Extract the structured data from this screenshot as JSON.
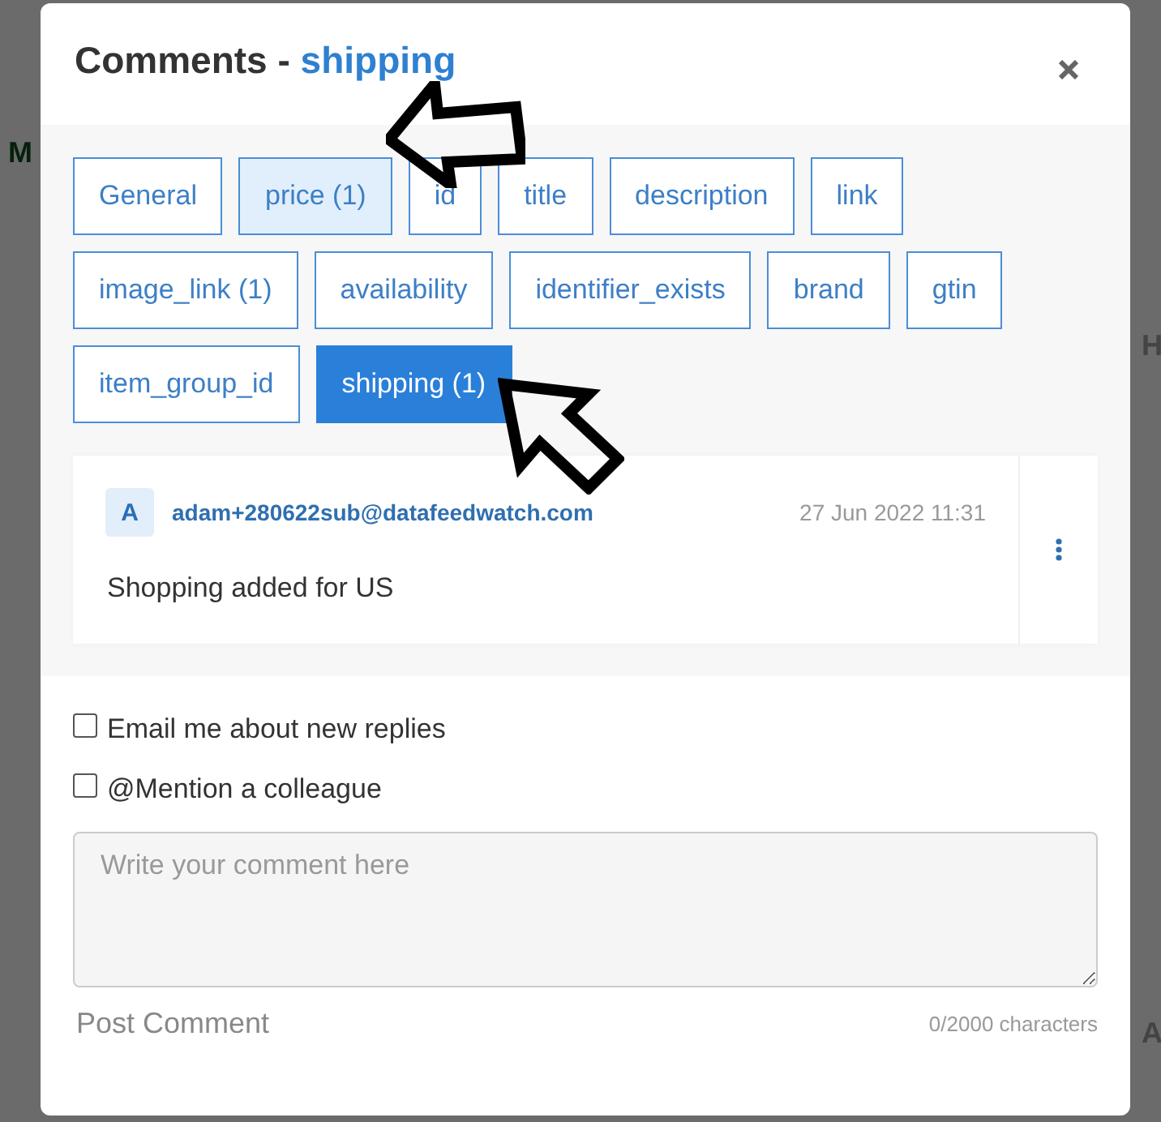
{
  "background": {
    "left_text": "M",
    "right_texts": [
      "H",
      "A"
    ]
  },
  "dialog": {
    "title": "Comments - ",
    "title_field": "shipping",
    "tabs": [
      {
        "label": "General",
        "selected": false,
        "highlighted": false
      },
      {
        "label": "price (1)",
        "selected": false,
        "highlighted": true
      },
      {
        "label": "id",
        "selected": false,
        "highlighted": false
      },
      {
        "label": "title",
        "selected": false,
        "highlighted": false
      },
      {
        "label": "description",
        "selected": false,
        "highlighted": false
      },
      {
        "label": "link",
        "selected": false,
        "highlighted": false
      },
      {
        "label": "image_link (1)",
        "selected": false,
        "highlighted": false
      },
      {
        "label": "availability",
        "selected": false,
        "highlighted": false
      },
      {
        "label": "identifier_exists",
        "selected": false,
        "highlighted": false
      },
      {
        "label": "brand",
        "selected": false,
        "highlighted": false
      },
      {
        "label": "gtin",
        "selected": false,
        "highlighted": false
      },
      {
        "label": "item_group_id",
        "selected": false,
        "highlighted": false
      },
      {
        "label": "shipping (1)",
        "selected": true,
        "highlighted": false
      }
    ],
    "comments": [
      {
        "avatar": "A",
        "author": "adam+280622sub@datafeedwatch.com",
        "date": "27 Jun 2022 11:31",
        "text": "Shopping added for US"
      }
    ],
    "options": [
      {
        "label": "Email me about new replies",
        "checked": false
      },
      {
        "label": "@Mention a colleague",
        "checked": false
      }
    ],
    "comment_field": {
      "placeholder": "Write your comment here"
    },
    "post_button": "Post Comment",
    "char_count": "0/2000 characters"
  }
}
